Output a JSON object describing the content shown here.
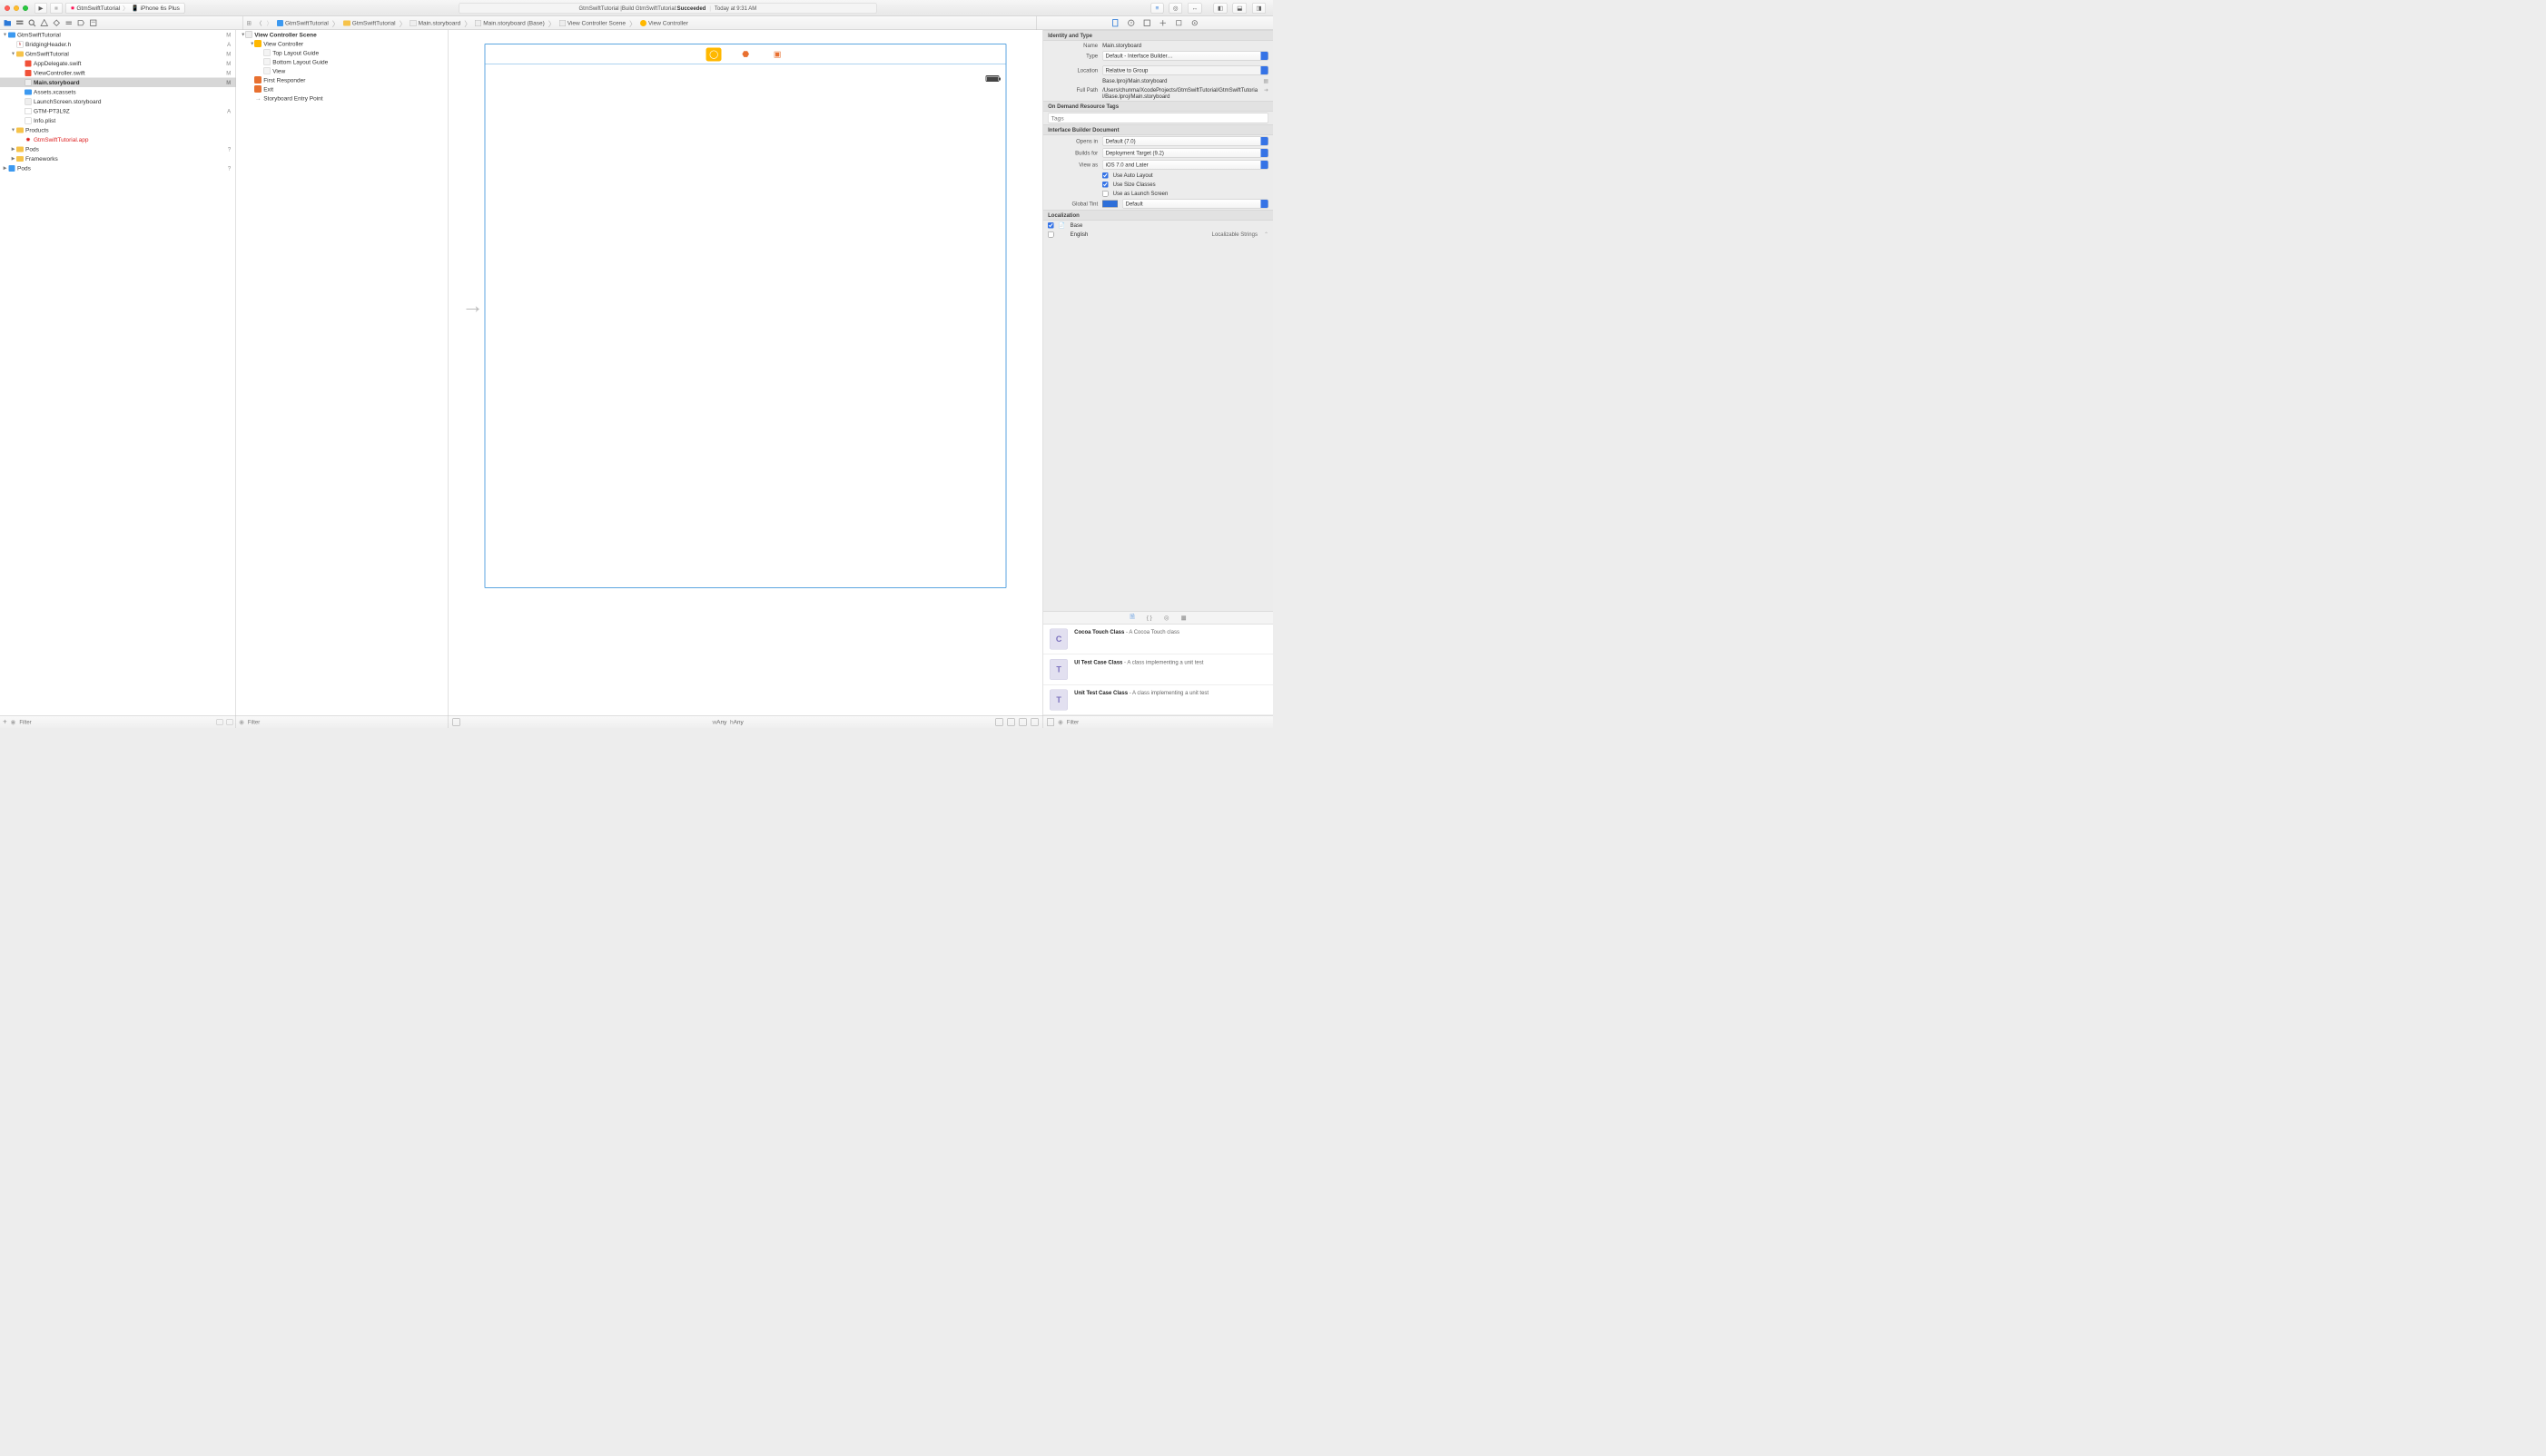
{
  "titlebar": {
    "scheme_target": "GtmSwiftTutorial",
    "scheme_device": "iPhone 6s Plus",
    "activity_prefix": "GtmSwiftTutorial |",
    "activity_build": " Build GtmSwiftTutorial: ",
    "activity_status": "Succeeded",
    "activity_time": "Today at 9:31 AM"
  },
  "breadcrumb": {
    "items": [
      "GtmSwiftTutorial",
      "GtmSwiftTutorial",
      "Main.storyboard",
      "Main.storyboard (Base)",
      "View Controller Scene",
      "View Controller"
    ]
  },
  "nav": {
    "filter_placeholder": "Filter",
    "tree": [
      {
        "label": "GtmSwiftTutorial",
        "indent": 0,
        "icon": "folder-blue",
        "disc": "▼",
        "status": "M"
      },
      {
        "label": "BridgingHeader.h",
        "indent": 1,
        "icon": "h",
        "status": "A"
      },
      {
        "label": "GtmSwiftTutorial",
        "indent": 1,
        "icon": "folder-y",
        "disc": "▼",
        "status": "M"
      },
      {
        "label": "AppDelegate.swift",
        "indent": 2,
        "icon": "swift",
        "status": "M"
      },
      {
        "label": "ViewController.swift",
        "indent": 2,
        "icon": "swift",
        "status": "M"
      },
      {
        "label": "Main.storyboard",
        "indent": 2,
        "icon": "xib",
        "status": "M",
        "selected": true
      },
      {
        "label": "Assets.xcassets",
        "indent": 2,
        "icon": "folder-blue"
      },
      {
        "label": "LaunchScreen.storyboard",
        "indent": 2,
        "icon": "xib"
      },
      {
        "label": "GTM-PT3L9Z",
        "indent": 2,
        "icon": "plist",
        "status": "A"
      },
      {
        "label": "Info.plist",
        "indent": 2,
        "icon": "plist"
      },
      {
        "label": "Products",
        "indent": 1,
        "icon": "folder-y",
        "disc": "▼"
      },
      {
        "label": "GtmSwiftTutorial.app",
        "indent": 2,
        "icon": "app",
        "cls": "appfile"
      },
      {
        "label": "Pods",
        "indent": 1,
        "icon": "folder-y",
        "disc": "▶",
        "status": "?"
      },
      {
        "label": "Frameworks",
        "indent": 1,
        "icon": "folder-y",
        "disc": "▶"
      },
      {
        "label": "Pods",
        "indent": 0,
        "icon": "pods",
        "disc": "▶",
        "status": "?"
      }
    ]
  },
  "outline": {
    "filter_placeholder": "Filter",
    "items": [
      {
        "label": "View Controller Scene",
        "indent": 0,
        "disc": "▼",
        "icon": "scene",
        "bold": true
      },
      {
        "label": "View Controller",
        "indent": 1,
        "disc": "▼",
        "icon": "vc"
      },
      {
        "label": "Top Layout Guide",
        "indent": 2,
        "icon": "guide"
      },
      {
        "label": "Bottom Layout Guide",
        "indent": 2,
        "icon": "guide"
      },
      {
        "label": "View",
        "indent": 2,
        "icon": "guide"
      },
      {
        "label": "First Responder",
        "indent": 1,
        "icon": "resp"
      },
      {
        "label": "Exit",
        "indent": 1,
        "icon": "exit"
      },
      {
        "label": "Storyboard Entry Point",
        "indent": 1,
        "icon": "arrow"
      }
    ]
  },
  "canvas": {
    "size_w": "Any",
    "size_h": "Any",
    "w_prefix": "w",
    "h_prefix": "h"
  },
  "inspector": {
    "sections": {
      "identity": "Identity and Type",
      "odr": "On Demand Resource Tags",
      "ibd": "Interface Builder Document",
      "loc": "Localization"
    },
    "name_label": "Name",
    "name_value": "Main.storyboard",
    "type_label": "Type",
    "type_value": "Default - Interface Builder…",
    "location_label": "Location",
    "location_value": "Relative to Group",
    "location_path": "Base.lproj/Main.storyboard",
    "fullpath_label": "Full Path",
    "fullpath_value": "/Users/chunma/XcodeProjects/GtmSwiftTutorial/GtmSwiftTutorial/Base.lproj/Main.storyboard",
    "tags_placeholder": "Tags",
    "opens_label": "Opens in",
    "opens_value": "Default (7.0)",
    "builds_label": "Builds for",
    "builds_value": "Deployment Target (9.2)",
    "viewas_label": "View as",
    "viewas_value": "iOS 7.0 and Later",
    "auto_layout": "Use Auto Layout",
    "size_classes": "Use Size Classes",
    "launch_screen": "Use as Launch Screen",
    "tint_label": "Global Tint",
    "tint_value": "Default",
    "loc_base": "Base",
    "loc_english": "English",
    "loc_strings": "Localizable Strings"
  },
  "library": {
    "filter_placeholder": "Filter",
    "items": [
      {
        "title": "Cocoa Touch Class",
        "desc": " - A Cocoa Touch class",
        "glyph": "C"
      },
      {
        "title": "UI Test Case Class",
        "desc": " - A class implementing a unit test",
        "glyph": "T"
      },
      {
        "title": "Unit Test Case Class",
        "desc": " - A class implementing a unit test",
        "glyph": "T"
      }
    ]
  }
}
